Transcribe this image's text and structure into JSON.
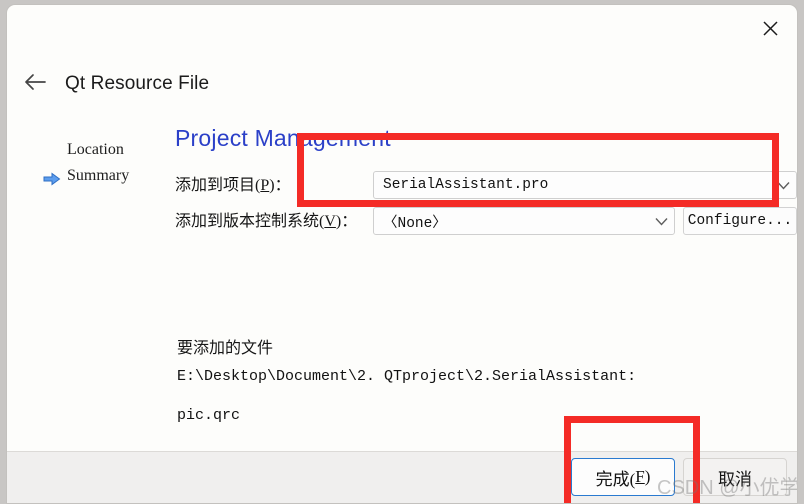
{
  "window": {
    "close_label": "✕",
    "back_label": "←",
    "title": "Qt Resource File"
  },
  "sidebar": {
    "items": [
      {
        "label": "Location",
        "current": false
      },
      {
        "label": "Summary",
        "current": true
      }
    ]
  },
  "main": {
    "page_title": "Project Management",
    "rows": [
      {
        "label_prefix": "添加到项目(",
        "label_accel": "P",
        "label_suffix": ")：",
        "value": "SerialAssistant.pro"
      },
      {
        "label_prefix": "添加到版本控制系统(",
        "label_accel": "V",
        "label_suffix": ")：",
        "value": "〈None〉"
      }
    ],
    "configure_label": "Configure...",
    "summary": {
      "heading": "要添加的文件",
      "path": "E:\\Desktop\\Document\\2. QTproject\\2.SerialAssistant:",
      "file": "pic.qrc"
    }
  },
  "footer": {
    "finish_prefix": "完成(",
    "finish_accel": "F",
    "finish_suffix": ")",
    "cancel_label": "取消"
  },
  "annotations": {
    "color": "#f42b26",
    "boxes": [
      "project-combo-highlight",
      "finish-button-highlight"
    ]
  },
  "watermark": {
    "text": "CSDN @小优学长"
  }
}
